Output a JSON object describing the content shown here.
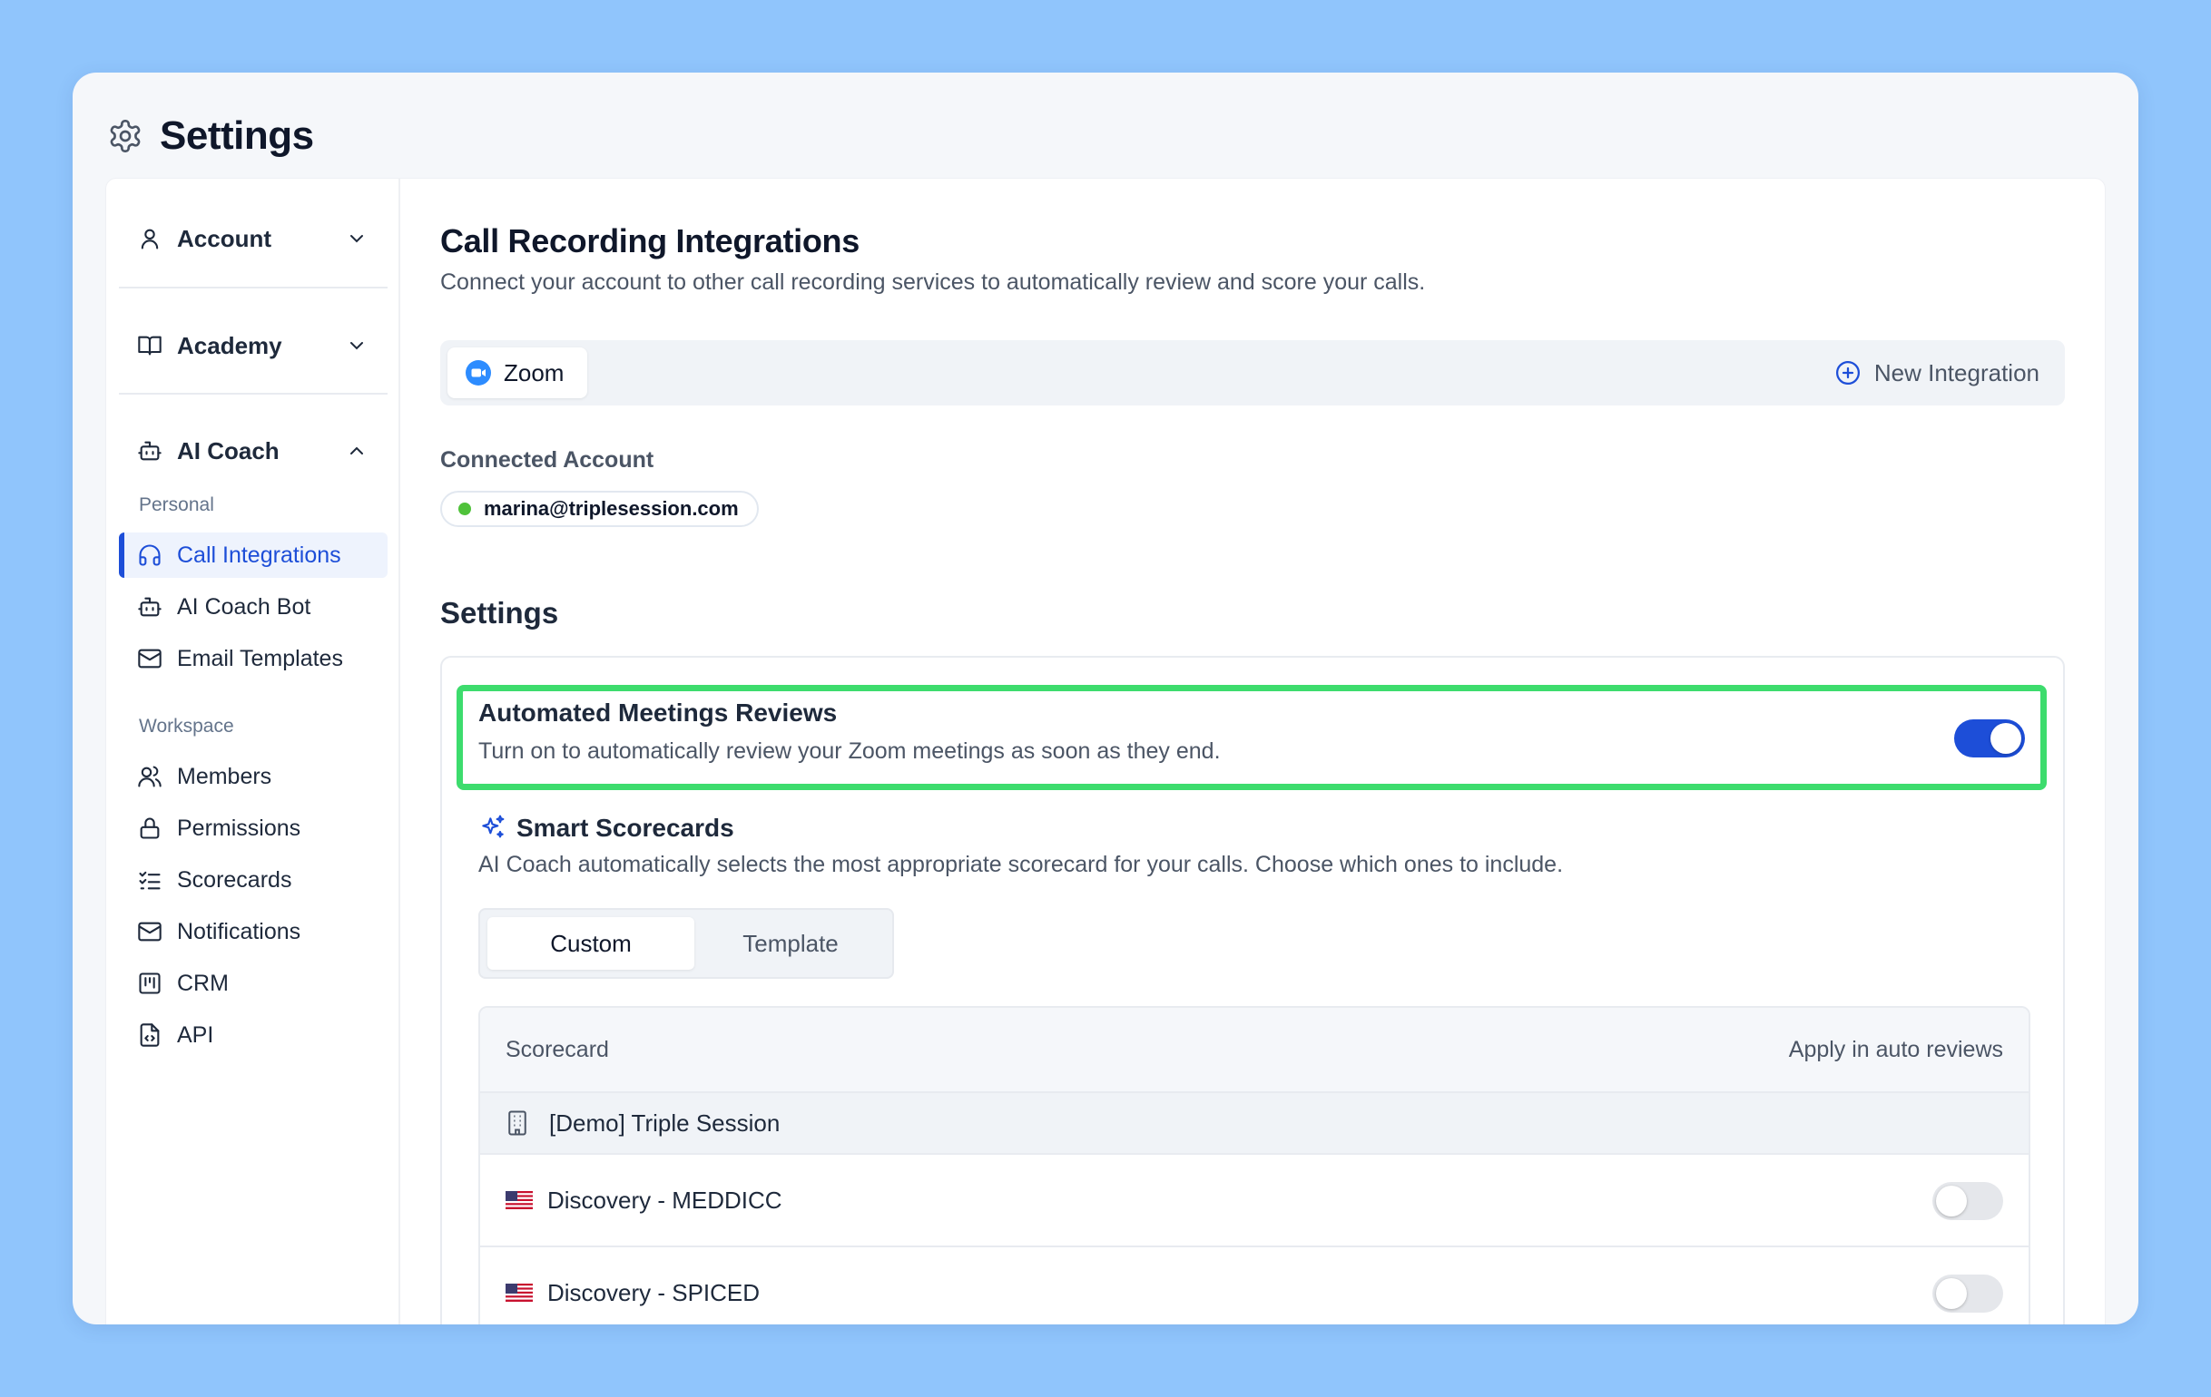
{
  "window": {
    "title": "Settings"
  },
  "sidebar": {
    "sections": [
      {
        "label": "Account",
        "icon": "user-icon",
        "expanded": false
      },
      {
        "label": "Academy",
        "icon": "book-icon",
        "expanded": false
      },
      {
        "label": "AI Coach",
        "icon": "bot-icon",
        "expanded": true
      }
    ],
    "groups": {
      "personal": {
        "label": "Personal",
        "items": [
          {
            "label": "Call Integrations",
            "icon": "headset-icon",
            "active": true
          },
          {
            "label": "AI Coach Bot",
            "icon": "bot-icon"
          },
          {
            "label": "Email Templates",
            "icon": "mail-icon"
          }
        ]
      },
      "workspace": {
        "label": "Workspace",
        "items": [
          {
            "label": "Members",
            "icon": "users-icon"
          },
          {
            "label": "Permissions",
            "icon": "lock-icon"
          },
          {
            "label": "Scorecards",
            "icon": "checklist-icon"
          },
          {
            "label": "Notifications",
            "icon": "mail-icon"
          },
          {
            "label": "CRM",
            "icon": "kanban-icon"
          },
          {
            "label": "API",
            "icon": "file-code-icon"
          }
        ]
      }
    }
  },
  "main": {
    "title": "Call Recording Integrations",
    "subtitle": "Connect your account to other call recording services to automatically review and score your calls.",
    "integrations": {
      "tabs": [
        {
          "label": "Zoom",
          "icon": "zoom-icon"
        }
      ],
      "new_label": "New Integration"
    },
    "connected": {
      "label": "Connected Account",
      "email": "marina@triplesession.com",
      "status_color": "#4fc23a"
    },
    "settings": {
      "heading": "Settings",
      "auto_review": {
        "title": "Automated Meetings Reviews",
        "description": "Turn on to automatically review your Zoom meetings as soon as they end.",
        "enabled": true
      },
      "smart": {
        "title": "Smart Scorecards",
        "description": "AI Coach automatically selects the most appropriate scorecard for your calls. Choose which ones to include."
      },
      "segment": {
        "options": [
          "Custom",
          "Template"
        ],
        "selected": "Custom"
      },
      "table": {
        "columns": [
          "Scorecard",
          "Apply in auto reviews"
        ],
        "group": "[Demo] Triple Session",
        "rows": [
          {
            "name": "Discovery - MEDDICC",
            "flag": "us-flag-icon",
            "enabled": false
          },
          {
            "name": "Discovery - SPICED",
            "flag": "us-flag-icon",
            "enabled": false
          }
        ]
      }
    }
  },
  "colors": {
    "accent": "#1d4ed8",
    "highlight": "#3ddc6d",
    "background": "#90c5fc"
  }
}
